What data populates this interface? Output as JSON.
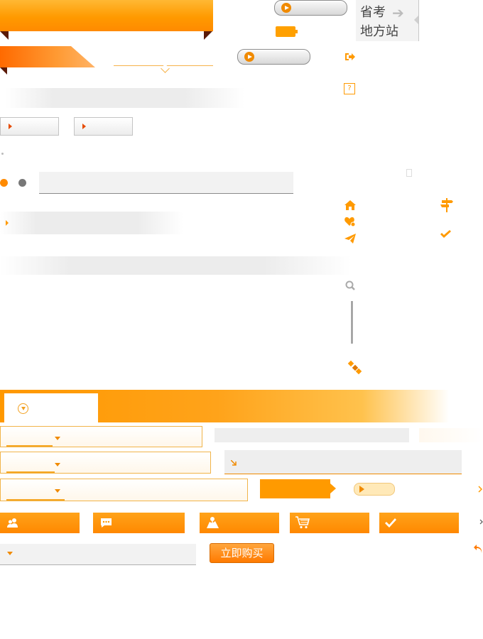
{
  "header": {
    "province_label_line1": "省考",
    "province_label_line2": "地方站",
    "arrow_glyph": "➔"
  },
  "buttons": {
    "buy_now": "立即购买"
  },
  "icons": {
    "logout": "logout-icon",
    "help": "question-icon",
    "help_glyph": "?",
    "home": "home-icon",
    "favorite": "heart-icon",
    "send": "paper-plane-icon",
    "signpost": "signpost-icon",
    "check": "check-icon",
    "search": "search-icon",
    "satellite": "satellite-icon",
    "users": "users-icon",
    "chat": "chat-icon",
    "map": "map-icon",
    "cart": "cart-icon",
    "undo": "undo-icon",
    "chevron_right": "chevron-right-icon"
  },
  "colors": {
    "accent_orange": "#ff9a00",
    "dark_fold": "#5a1a08",
    "gray_dot": "#777777"
  }
}
